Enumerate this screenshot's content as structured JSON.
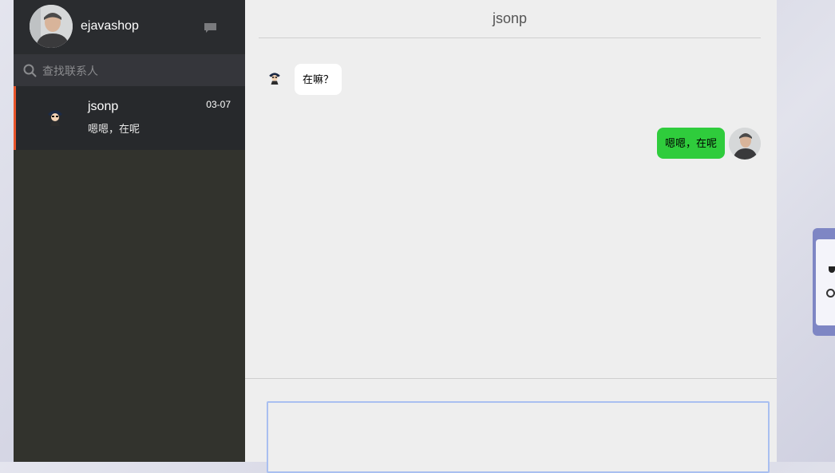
{
  "user": {
    "name": "ejavashop"
  },
  "search": {
    "placeholder": "查找联系人"
  },
  "contacts": [
    {
      "name": "jsonp",
      "last_message": "嗯嗯，在呢",
      "date": "03-07"
    }
  ],
  "chat": {
    "title": "jsonp",
    "messages": [
      {
        "from": "contact",
        "text": "在嘛？"
      },
      {
        "from": "me",
        "text": "嗯嗯，在呢"
      }
    ],
    "composer_value": ""
  },
  "colors": {
    "sidebar_bg": "#32332d",
    "active_indicator": "#e8542a",
    "sent_bubble": "#2fcc3c",
    "received_bubble": "#ffffff"
  },
  "icons": [
    "chat-bubble-icon",
    "search-icon"
  ]
}
